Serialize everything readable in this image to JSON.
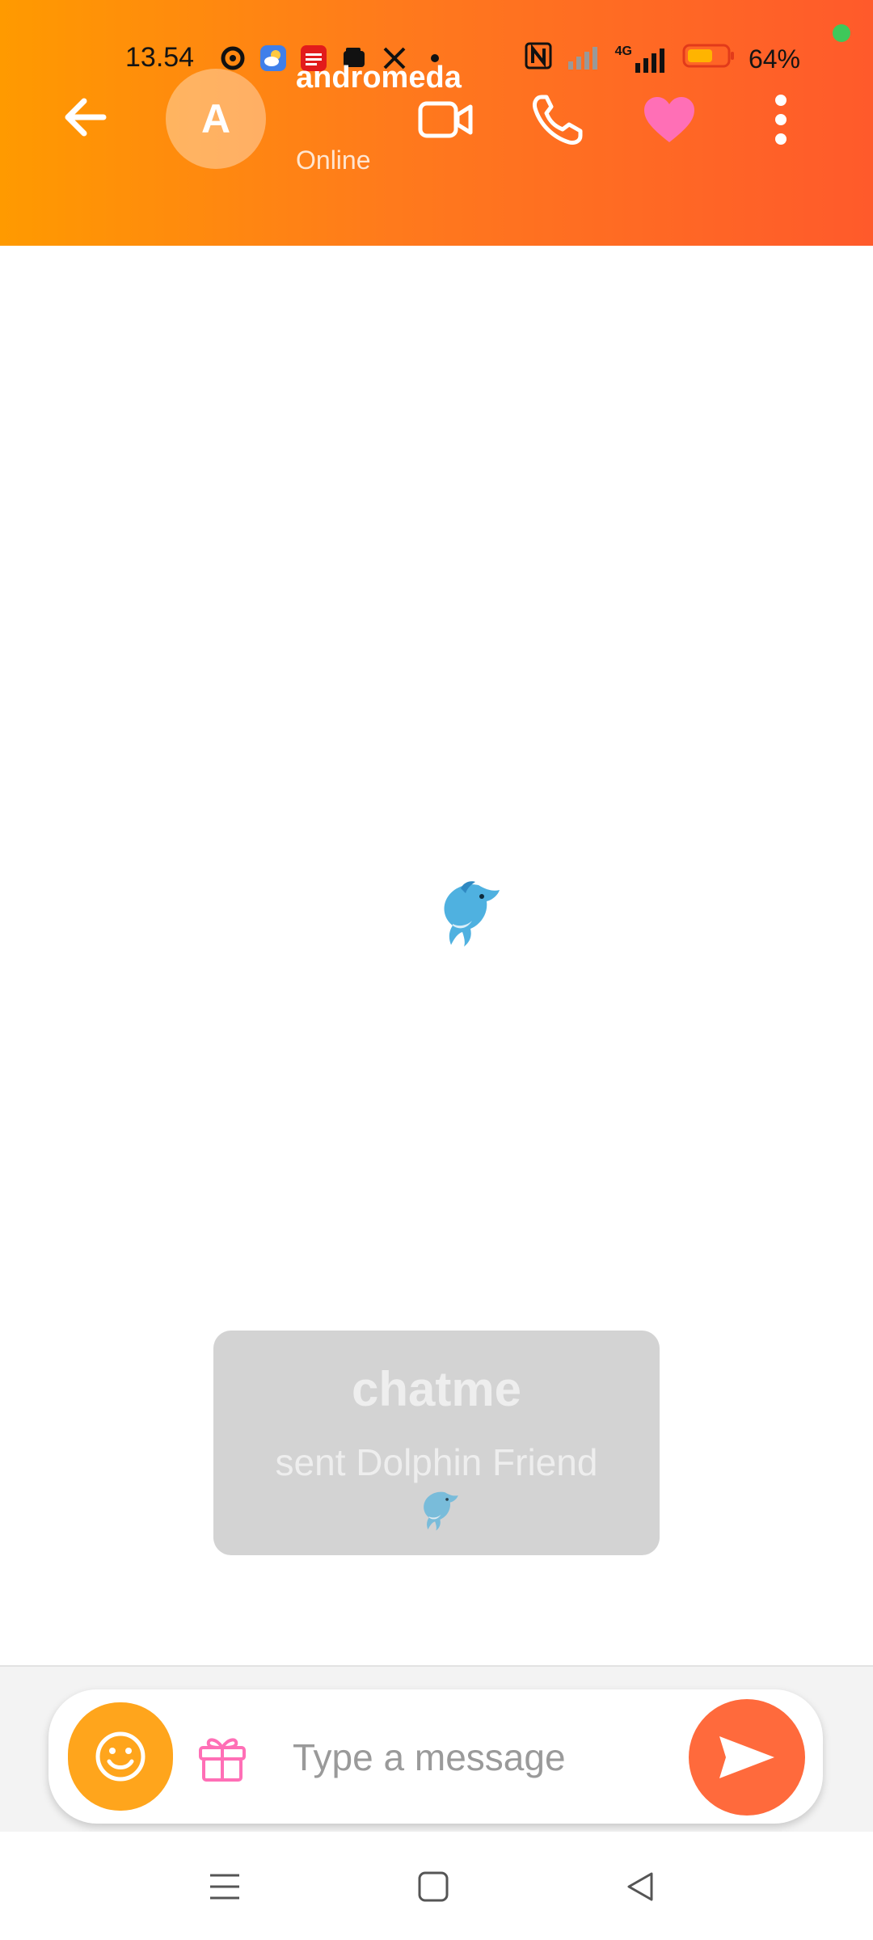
{
  "status_bar": {
    "time": "13.54",
    "network": "4G",
    "battery": "64%",
    "colors": {
      "battery_fill": "#ffb400",
      "battery_outline": "#e23a1a",
      "privacy_dot": "#3ec85a"
    }
  },
  "header": {
    "avatar_initial": "A",
    "contact_name": "andromeda",
    "contact_status": "Online",
    "icons": [
      "back-arrow-icon",
      "video-call-icon",
      "phone-call-icon",
      "heart-icon",
      "more-vert-icon"
    ],
    "colors": {
      "gradient_start": "#ff9a00",
      "gradient_end": "#ff5a2b",
      "heart": "#ff6fb6"
    }
  },
  "chat": {
    "center_emoji": "dolphin",
    "system_notice": {
      "title": "chatme",
      "text": "sent Dolphin Friend",
      "emoji": "dolphin"
    }
  },
  "composer": {
    "placeholder": "Type a message",
    "value": "",
    "icons": [
      "smiley-icon",
      "gift-icon",
      "send-icon"
    ],
    "colors": {
      "emoji_button": "#ffa51c",
      "gift": "#ff6fb6",
      "send_button": "#ff6a3c"
    }
  },
  "nav_bar": {
    "icons": [
      "menu-icon",
      "home-icon",
      "back-triangle-icon"
    ]
  }
}
